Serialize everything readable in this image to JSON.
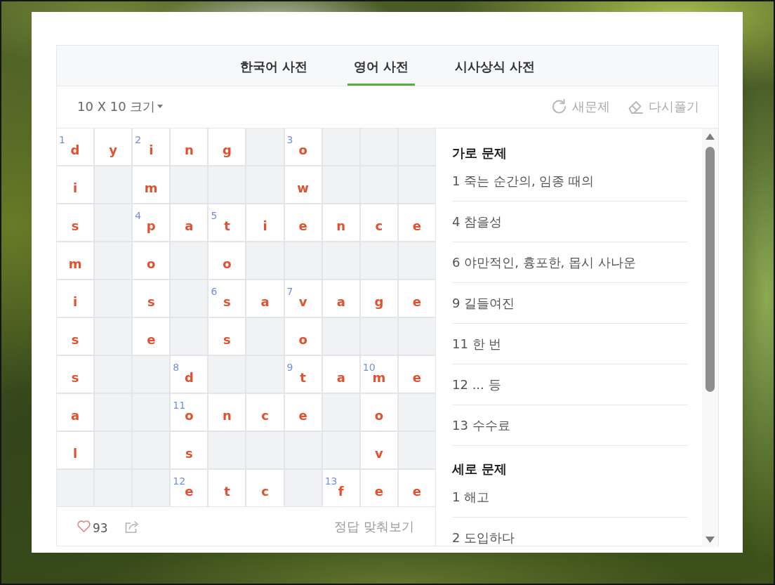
{
  "tabs": [
    {
      "label": "한국어 사전",
      "selected": false
    },
    {
      "label": "영어 사전",
      "selected": true
    },
    {
      "label": "시사상식 사전",
      "selected": false
    }
  ],
  "toolbar": {
    "size_dropdown": "10 X 10 크기",
    "actions": [
      {
        "kind": "refresh",
        "label": "새문제"
      },
      {
        "kind": "erase",
        "label": "다시풀기"
      }
    ]
  },
  "grid": {
    "rows": [
      [
        {
          "letter": "d",
          "number": "1"
        },
        {
          "letter": "y"
        },
        {
          "letter": "i",
          "number": "2"
        },
        {
          "letter": "n"
        },
        {
          "letter": "g"
        },
        null,
        {
          "letter": "o",
          "number": "3"
        },
        null,
        null,
        null
      ],
      [
        {
          "letter": "i"
        },
        null,
        {
          "letter": "m"
        },
        null,
        null,
        null,
        {
          "letter": "w"
        },
        null,
        null,
        null
      ],
      [
        {
          "letter": "s"
        },
        null,
        {
          "letter": "p",
          "number": "4"
        },
        {
          "letter": "a"
        },
        {
          "letter": "t",
          "number": "5"
        },
        {
          "letter": "i"
        },
        {
          "letter": "e"
        },
        {
          "letter": "n"
        },
        {
          "letter": "c"
        },
        {
          "letter": "e"
        }
      ],
      [
        {
          "letter": "m"
        },
        null,
        {
          "letter": "o"
        },
        null,
        {
          "letter": "o"
        },
        null,
        null,
        null,
        null,
        null
      ],
      [
        {
          "letter": "i"
        },
        null,
        {
          "letter": "s"
        },
        null,
        {
          "letter": "s",
          "number": "6"
        },
        {
          "letter": "a"
        },
        {
          "letter": "v",
          "number": "7"
        },
        {
          "letter": "a"
        },
        {
          "letter": "g"
        },
        {
          "letter": "e"
        }
      ],
      [
        {
          "letter": "s"
        },
        null,
        {
          "letter": "e"
        },
        null,
        {
          "letter": "s"
        },
        null,
        {
          "letter": "o"
        },
        null,
        null,
        null
      ],
      [
        {
          "letter": "s"
        },
        null,
        null,
        {
          "letter": "d",
          "number": "8"
        },
        null,
        null,
        {
          "letter": "t",
          "number": "9"
        },
        {
          "letter": "a"
        },
        {
          "letter": "m",
          "number": "10"
        },
        {
          "letter": "e"
        }
      ],
      [
        {
          "letter": "a"
        },
        null,
        null,
        {
          "letter": "o",
          "number": "11"
        },
        {
          "letter": "n"
        },
        {
          "letter": "c"
        },
        {
          "letter": "e"
        },
        null,
        {
          "letter": "o"
        },
        null
      ],
      [
        {
          "letter": "l"
        },
        null,
        null,
        {
          "letter": "s"
        },
        null,
        null,
        null,
        null,
        {
          "letter": "v"
        },
        null
      ],
      [
        null,
        null,
        null,
        {
          "letter": "e",
          "number": "12"
        },
        {
          "letter": "t"
        },
        {
          "letter": "c"
        },
        null,
        {
          "letter": "f",
          "number": "13"
        },
        {
          "letter": "e"
        },
        {
          "letter": "e"
        }
      ]
    ]
  },
  "footer": {
    "likes": "93",
    "check_answers": "정답 맞춰보기"
  },
  "clues": [
    {
      "title": "가로 문제",
      "items": [
        "1 죽는 순간의, 임종 때의",
        "4 참을성",
        "6 야만적인, 흉포한, 몹시 사나운",
        "9 길들여진",
        "11 한 번",
        "12 ... 등",
        "13 수수료"
      ]
    },
    {
      "title": "세로 문제",
      "items": [
        "1 해고",
        "2 도입하다"
      ]
    }
  ]
}
